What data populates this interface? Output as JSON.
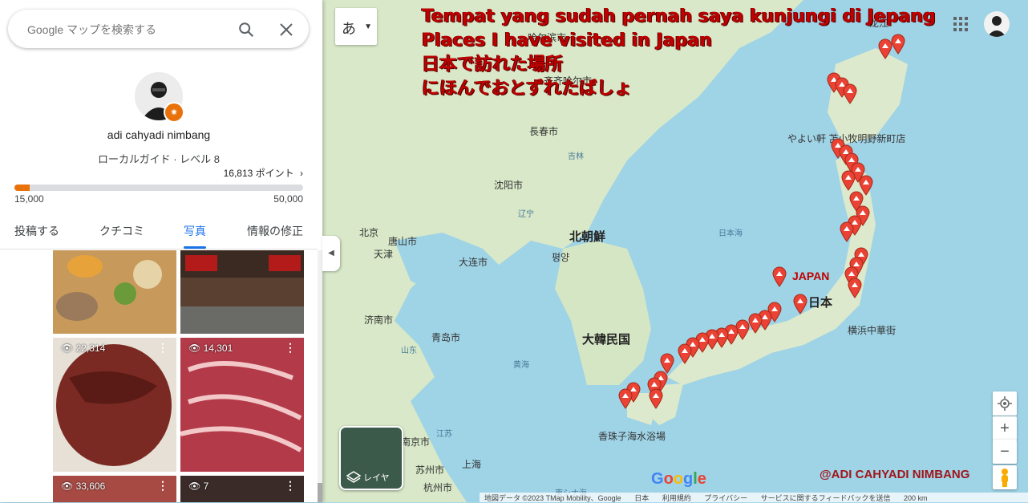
{
  "search": {
    "placeholder": "Google マップを検索する"
  },
  "profile": {
    "name": "adi cahyadi nimbang",
    "level": "ローカルガイド · レベル 8",
    "points": "16,813 ポイント",
    "progress_min": "15,000",
    "progress_max": "50,000",
    "progress_fraction": 0.052
  },
  "tabs": [
    "投稿する",
    "クチコミ",
    "写真",
    "情報の修正"
  ],
  "active_tab": "写真",
  "photos": [
    {
      "views": "",
      "color": "#c79a5c"
    },
    {
      "views": "",
      "color": "#5a4030"
    },
    {
      "views": "22,314",
      "color": "#7a2a22"
    },
    {
      "views": "14,301",
      "color": "#b33a48"
    },
    {
      "views": "33,606",
      "color": "#a84a44"
    },
    {
      "views": "7",
      "color": "#3a2a28"
    }
  ],
  "overlay": {
    "line1": "Tempat yang sudah pernah saya kunjungi di Jepang",
    "line2": "Places I have visited in Japan",
    "line3": "日本で訪れた場所",
    "line4": "にほんでおとずれたばしょ",
    "japan": "JAPAN",
    "credit": "@ADI CAHYADI NIMBANG"
  },
  "map_labels": {
    "changchun": "長春市",
    "shenyang": "沈阳市",
    "beijing": "北京",
    "tangshan": "唐山市",
    "tianjin": "天津",
    "dalian": "大连市",
    "jinan": "济南市",
    "qingdao": "青岛市",
    "nanjing": "南京市",
    "suzhou": "苏州市",
    "shanghai": "上海",
    "hangzhou": "杭州市",
    "north_korea": "北朝鮮",
    "pyongyang": "평양",
    "south_korea": "大韓民国",
    "japan": "日本",
    "sea_of_japan": "日本海",
    "yellow_sea": "黄海",
    "yokohama": "横浜中華街",
    "tomakomai": "やよい軒 苫小牧明野新町店",
    "kagoshima": "香珠子海水浴場",
    "jilin": "吉林",
    "liaoning": "辽宁",
    "shandong": "山东",
    "jiangsu": "江苏",
    "east_china_sea": "東シナ海",
    "heilongjiang": "龙江",
    "harbin": "哈尔滨市",
    "qiqihar": "齐齐哈尔市"
  },
  "controls": {
    "ime_label": "あ",
    "layer_label": "レイヤ",
    "zoom_in": "+",
    "zoom_out": "−"
  },
  "footer": [
    "地図データ ©2023 TMap Mobility、Google",
    "日本",
    "利用規約",
    "プライバシー",
    "サービスに関するフィードバックを送信",
    "200 km"
  ],
  "google_logo": "Google"
}
